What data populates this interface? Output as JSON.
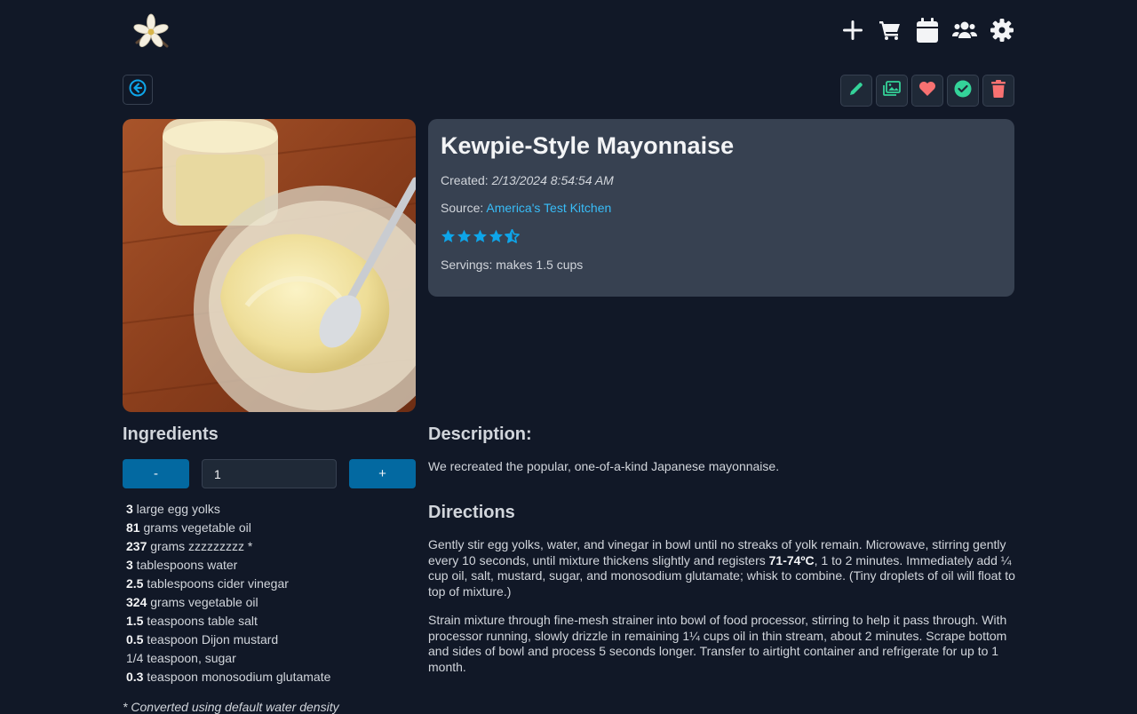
{
  "header": {
    "logo": "vanilla-flower-logo",
    "icons": [
      "plus-icon",
      "cart-icon",
      "calendar-icon",
      "users-icon",
      "gear-icon"
    ]
  },
  "toolbar": {
    "back": "arrow-left-circle-icon",
    "actions": [
      "pencil-icon",
      "images-icon",
      "heart-icon",
      "check-circle-icon",
      "trash-icon"
    ]
  },
  "recipe": {
    "title": "Kewpie-Style Mayonnaise",
    "created_label": "Created:",
    "created_value": "2/13/2024 8:54:54 AM",
    "source_label": "Source:",
    "source_value": "America's Test Kitchen",
    "rating": 4.5,
    "servings_label": "Servings:",
    "servings_value": "makes 1.5 cups"
  },
  "ingredients": {
    "heading": "Ingredients",
    "minus_label": "-",
    "plus_label": "+",
    "scale_value": "1",
    "items": [
      {
        "qty": "3",
        "text": " large egg yolks"
      },
      {
        "qty": "81",
        "text": " grams vegetable oil"
      },
      {
        "qty": "237",
        "text": " grams zzzzzzzzz *"
      },
      {
        "qty": "3",
        "text": " tablespoons water"
      },
      {
        "qty": "2.5",
        "text": " tablespoons cider vinegar"
      },
      {
        "qty": "324",
        "text": " grams vegetable oil"
      },
      {
        "qty": "1.5",
        "text": " teaspoons table salt"
      },
      {
        "qty": "0.5",
        "text": " teaspoon Dijon mustard"
      },
      {
        "qty": "",
        "text": "1/4 teaspoon, sugar"
      },
      {
        "qty": "0.3",
        "text": " teaspoon monosodium glutamate"
      }
    ],
    "note": "* Converted using default water density"
  },
  "description": {
    "heading": "Description:",
    "text": "We recreated the popular, one-of-a-kind Japanese mayonnaise."
  },
  "directions": {
    "heading": "Directions",
    "step1_a": "Gently stir egg yolks, water, and vinegar in bowl until no streaks of yolk remain. Microwave, stirring gently every 10 seconds, until mixture thickens slightly and registers ",
    "step1_bold": "71-74ºC",
    "step1_b": ", 1 to 2 minutes. Immediately add ¼ cup oil, salt, mustard, sugar, and monosodium glutamate; whisk to combine. (Tiny droplets of oil will float to top of mixture.)",
    "step2": "Strain mixture through fine-mesh strainer into bowl of food processor, stirring to help it pass through. With processor running, slowly drizzle in remaining 1¼ cups oil in thin stream, about 2 minutes. Scrape bottom and sides of bowl and process 5 seconds longer. Transfer to airtight container and refrigerate for up to 1 month."
  },
  "colors": {
    "background": "#111827",
    "card": "#374151",
    "accent": "#0ea5e9",
    "button": "#0369a1",
    "edit": "#34d399",
    "heart": "#f87171",
    "done": "#34d399",
    "delete": "#f87171"
  }
}
